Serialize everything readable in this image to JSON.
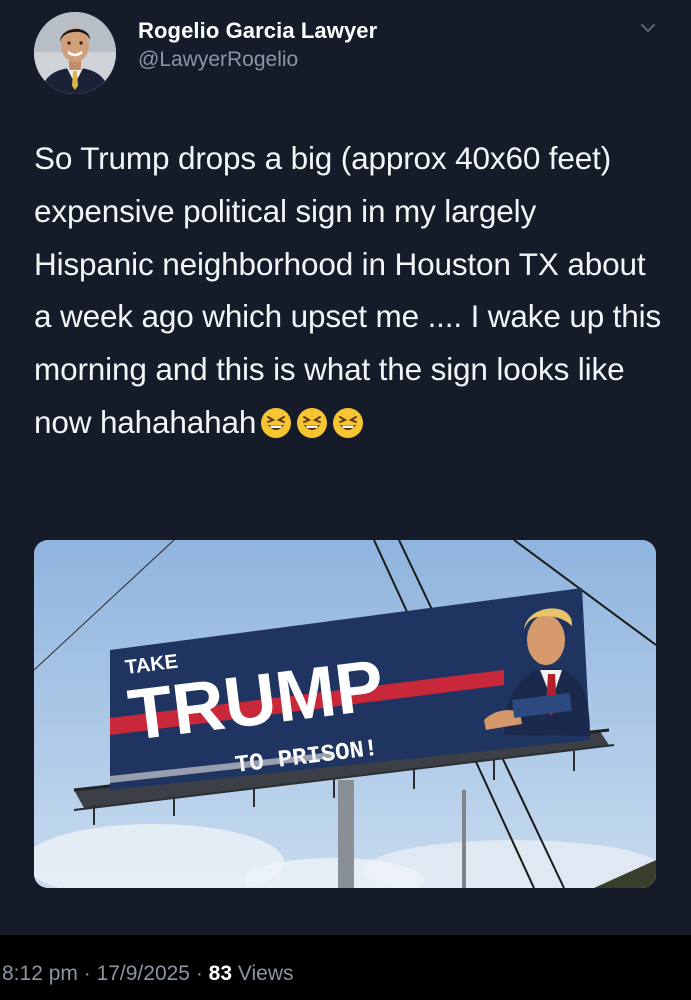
{
  "author": {
    "display_name": "Rogelio Garcia Lawyer",
    "handle": "@LawyerRogelio"
  },
  "tweet": {
    "text": "So Trump drops a big (approx 40x60 feet) expensive political sign in my largely Hispanic neighborhood in Houston TX about a week ago which upset me .... I wake up this morning and this is what the sign looks like now hahahahah",
    "emojis": [
      "grinning-squinting-face",
      "grinning-squinting-face",
      "grinning-squinting-face"
    ]
  },
  "media": {
    "billboard": {
      "line1": "TAKE",
      "line2": "TRUMP",
      "line3": "TO PRISON!"
    }
  },
  "meta": {
    "time": "8:12 pm",
    "sep1": " · ",
    "date": "17/9/2025",
    "sep2": " · ",
    "views_count": "83",
    "views_label": " Views"
  },
  "colors": {
    "background": "#151b28",
    "secondary_text": "#8b95a3",
    "billboard_blue": "#1f3460",
    "billboard_red": "#c8283a"
  },
  "icons": {
    "more": "chevron-down-icon"
  }
}
